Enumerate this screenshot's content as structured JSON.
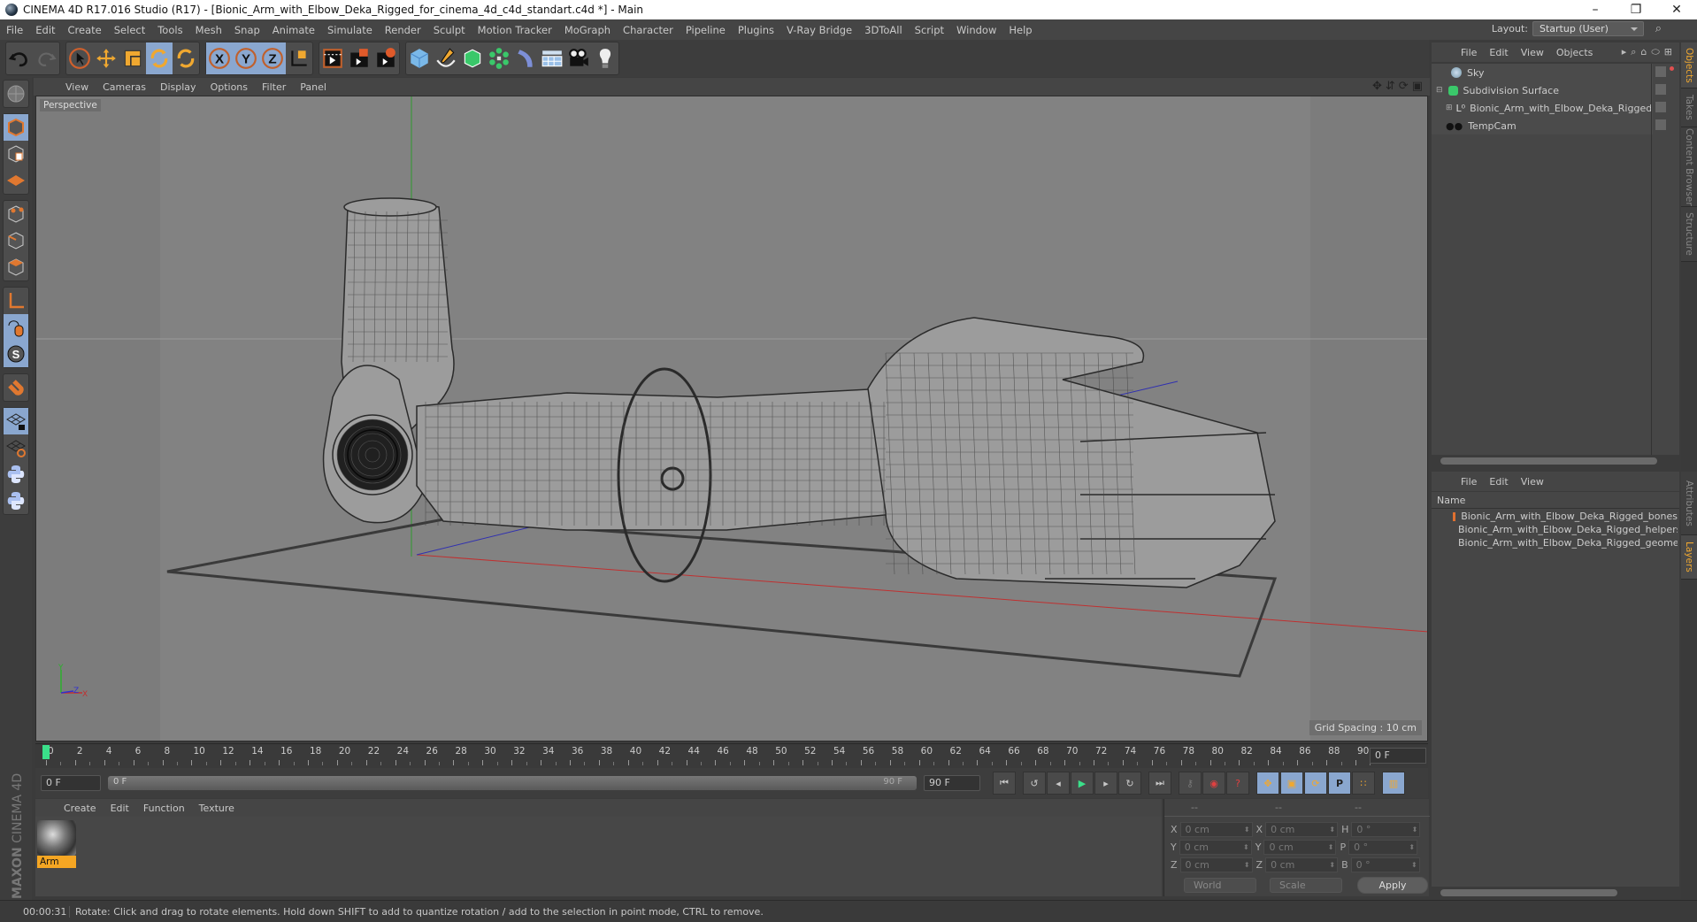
{
  "window": {
    "title": "CINEMA 4D R17.016 Studio (R17) - [Bionic_Arm_with_Elbow_Deka_Rigged_for_cinema_4d_c4d_standart.c4d *] - Main",
    "controls": [
      "minimize",
      "restore",
      "close"
    ]
  },
  "menubar": {
    "items": [
      "File",
      "Edit",
      "Create",
      "Select",
      "Tools",
      "Mesh",
      "Snap",
      "Animate",
      "Simulate",
      "Render",
      "Sculpt",
      "Motion Tracker",
      "MoGraph",
      "Character",
      "Pipeline",
      "Plugins",
      "V-Ray Bridge",
      "3DToAll",
      "Script",
      "Window",
      "Help"
    ],
    "layout_label": "Layout:",
    "layout_value": "Startup (User)"
  },
  "toolbar": {
    "groups": [
      [
        "undo-icon",
        "redo-icon"
      ],
      [
        "select-pointer-icon",
        "move-icon",
        "scale-icon",
        "rotate-icon",
        "recent-tool-icon"
      ],
      [
        "x-axis-icon",
        "y-axis-icon",
        "z-axis-icon",
        "coordinate-system-icon"
      ],
      [
        "render-view-icon",
        "render-picture-viewer-icon",
        "render-settings-icon"
      ],
      [
        "cube-icon",
        "pen-spline-icon",
        "subdivision-icon",
        "array-icon",
        "deformer-icon",
        "floor-icon",
        "camera-icon",
        "light-icon"
      ]
    ],
    "active": [
      "rotate-icon",
      "x-axis-icon",
      "y-axis-icon",
      "z-axis-icon"
    ]
  },
  "left_toolbar": {
    "items": [
      "make-editable-icon",
      "model-mode-icon",
      "texture-mode-icon",
      "workplane-mode-icon",
      "points-mode-icon",
      "edges-mode-icon",
      "polygons-mode-icon",
      "axis-mode-icon",
      "tweak-mode-icon",
      "snap-icon",
      "magnet-icon",
      "lock-workplane-icon",
      "workplane-icon",
      "python-icon",
      "python-script-icon"
    ],
    "active": [
      "model-mode-icon",
      "tweak-mode-icon",
      "snap-icon",
      "lock-workplane-icon"
    ]
  },
  "viewport": {
    "menu": [
      "View",
      "Cameras",
      "Display",
      "Options",
      "Filter",
      "Panel"
    ],
    "label": "Perspective",
    "grid_spacing": "Grid Spacing : 10 cm",
    "axis_labels": {
      "y": "Y",
      "z": "Z",
      "x": "X"
    },
    "nav_icons": [
      "move-view-icon",
      "zoom-view-icon",
      "rotate-view-icon",
      "maximize-view-icon"
    ]
  },
  "timeline": {
    "ticks": [
      "0",
      "2",
      "4",
      "6",
      "8",
      "10",
      "12",
      "14",
      "16",
      "18",
      "20",
      "22",
      "24",
      "26",
      "28",
      "30",
      "32",
      "34",
      "36",
      "38",
      "40",
      "42",
      "44",
      "46",
      "48",
      "50",
      "52",
      "54",
      "56",
      "58",
      "60",
      "62",
      "64",
      "66",
      "68",
      "70",
      "72",
      "74",
      "76",
      "78",
      "80",
      "82",
      "84",
      "86",
      "88",
      "90"
    ],
    "current_frame": "0 F",
    "playhead_frame": 0,
    "frame_range_max": 90
  },
  "transport": {
    "start_field": "0 F",
    "range_start": "0 F",
    "range_end": "90 F",
    "end_field": "90 F",
    "buttons": [
      "goto-start-icon",
      "prev-key-icon",
      "prev-frame-icon",
      "play-icon",
      "next-frame-icon",
      "next-key-icon",
      "goto-end-icon",
      "record-disabled-icon",
      "autokey-icon",
      "keyframe-selection-icon",
      "move-key-icon",
      "scale-key-icon",
      "rotate-key-icon",
      "param-key-icon",
      "pla-key-icon",
      "timeline-icon"
    ]
  },
  "material_manager": {
    "menu": [
      "Create",
      "Edit",
      "Function",
      "Texture"
    ],
    "materials": [
      {
        "name": "Arm"
      }
    ]
  },
  "brand": {
    "line1": "MAXON",
    "line2": "CINEMA 4D"
  },
  "coordinates": {
    "headers": [
      "--",
      "--",
      "--"
    ],
    "rows": [
      {
        "a": "X",
        "av": "0 cm",
        "b": "X",
        "bv": "0 cm",
        "c": "H",
        "cv": "0 °"
      },
      {
        "a": "Y",
        "av": "0 cm",
        "b": "Y",
        "bv": "0 cm",
        "c": "P",
        "cv": "0 °"
      },
      {
        "a": "Z",
        "av": "0 cm",
        "b": "Z",
        "bv": "0 cm",
        "c": "B",
        "cv": "0 °"
      }
    ],
    "space": "World",
    "mode": "Scale",
    "apply": "Apply"
  },
  "object_manager": {
    "menu": [
      "File",
      "Edit",
      "View",
      "Objects"
    ],
    "objects": [
      {
        "name": "Sky",
        "icon": "sky-icon",
        "depth": 0
      },
      {
        "name": "Subdivision Surface",
        "icon": "subdivision-surface-icon",
        "depth": 0,
        "expanded": true
      },
      {
        "name": "Bionic_Arm_with_Elbow_Deka_Rigged",
        "icon": "null-object-icon",
        "depth": 1,
        "collapsed": true
      },
      {
        "name": "TempCam",
        "icon": "camera-icon",
        "depth": 0
      }
    ]
  },
  "layer_manager": {
    "menu": [
      "File",
      "Edit",
      "View"
    ],
    "header": "Name",
    "layers": [
      {
        "name": "Bionic_Arm_with_Elbow_Deka_Rigged_bones",
        "color": "#e07030"
      },
      {
        "name": "Bionic_Arm_with_Elbow_Deka_Rigged_helpers",
        "color": "#30d890"
      },
      {
        "name": "Bionic_Arm_with_Elbow_Deka_Rigged_geometry",
        "color": "#40d8e0"
      }
    ]
  },
  "side_tabs": {
    "top": [
      {
        "label": "Objects",
        "active": true
      },
      {
        "label": "Takes"
      },
      {
        "label": "Content Browser"
      },
      {
        "label": "Structure"
      }
    ],
    "bottom": [
      {
        "label": "Attributes"
      },
      {
        "label": "Layers",
        "active": true
      }
    ]
  },
  "status": {
    "time": "00:00:31",
    "message": "Rotate: Click and drag to rotate elements. Hold down SHIFT to add to quantize rotation / add to the selection in point mode, CTRL to remove."
  }
}
